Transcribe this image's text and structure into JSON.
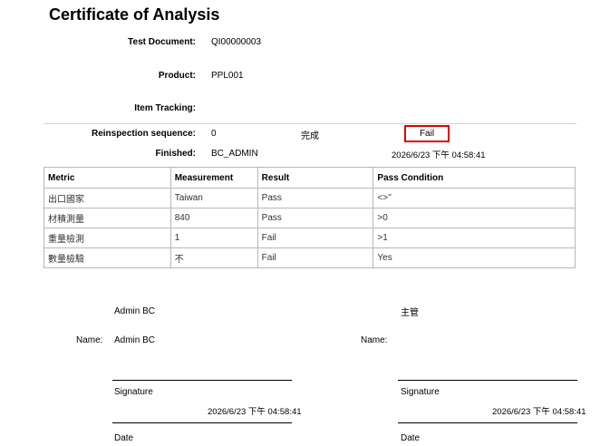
{
  "title": "Certificate of Analysis",
  "fields": {
    "test_document_label": "Test Document:",
    "test_document_value": "QI00000003",
    "product_label": "Product:",
    "product_value": "PPL001",
    "item_tracking_label": "Item Tracking:",
    "item_tracking_value": "",
    "reinspection_label": "Reinspection sequence:",
    "reinspection_value": "0",
    "status_text": "完成",
    "result_badge": "Fail",
    "finished_label": "Finished:",
    "finished_value": "BC_ADMIN",
    "finished_datetime": "2026/6/23 下午 04:58:41"
  },
  "table": {
    "headers": [
      "Metric",
      "Measurement",
      "Result",
      "Pass Condition"
    ],
    "rows": [
      [
        "出口國家",
        "Taiwan",
        "Pass",
        "<>''"
      ],
      [
        "材積測量",
        "840",
        "Pass",
        ">0"
      ],
      [
        "重量檢測",
        "1",
        "Fail",
        ">1"
      ],
      [
        "數量檢驗",
        "不",
        "Fail",
        "Yes"
      ]
    ]
  },
  "signatures": {
    "left": {
      "top_name": "Admin BC",
      "name_label": "Name:",
      "name_value": "Admin BC",
      "signature_label": "Signature",
      "datetime": "2026/6/23 下午 04:58:41",
      "date_label": "Date"
    },
    "right": {
      "top_name": "主管",
      "name_label": "Name:",
      "name_value": "",
      "signature_label": "Signature",
      "datetime": "2026/6/23 下午 04:58:41",
      "date_label": "Date"
    }
  },
  "colors": {
    "highlight_border": "#e00000",
    "grid": "#b8b8b8"
  }
}
